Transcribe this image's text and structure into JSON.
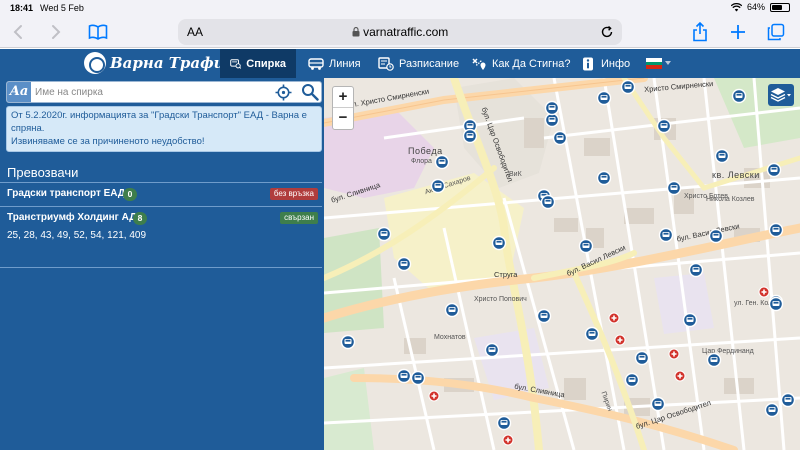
{
  "status_bar": {
    "time": "18:41",
    "date": "Wed 5 Feb",
    "battery": "64%",
    "battery_level": 0.64
  },
  "browser": {
    "aa": "AA",
    "url": "varnatraffic.com"
  },
  "app": {
    "logo_text": "Варна Трафик",
    "nav": [
      {
        "label": "Спирка",
        "icon": "bus-stop-icon",
        "active": true
      },
      {
        "label": "Линия",
        "icon": "bus-icon",
        "active": false
      },
      {
        "label": "Разписание",
        "icon": "timetable-icon",
        "active": false
      },
      {
        "label": "Как Да Стигна?",
        "icon": "directions-icon",
        "active": false
      },
      {
        "label": "Инфо",
        "icon": "info-icon",
        "active": false
      }
    ],
    "language_flag_colors": [
      "#ffffff",
      "#00966e",
      "#d62612"
    ]
  },
  "sidebar": {
    "aa_badge": "Aa",
    "search_placeholder": "Име на спирка",
    "notice": "От 5.2.2020г. информацията за \"Градски Транспорт\" ЕАД - Варна е спряна.\nИзвиняваме се за причиненото неудобство!",
    "carriers_title": "Превозвачи",
    "carriers": [
      {
        "name": "Градски транспорт ЕАД",
        "count": "0",
        "status": "без връзка",
        "connected": false
      },
      {
        "name": "Транстриумф Холдинг АД",
        "count": "8",
        "status": "свързан",
        "connected": true
      }
    ],
    "lines": "25, 28, 43, 49, 52, 54, 121, 409"
  },
  "map": {
    "zoom_in": "+",
    "zoom_out": "−",
    "labels": {
      "hristo_smirnenski": "бул. Христо Смирненски",
      "hristo_smirnenski_2": "Христо Смирненски",
      "pobeda": "Победа",
      "flora": "Флора",
      "vik": "ВиК",
      "kv_levski": "кв. Левски",
      "vasil_levski": "бул. Васил Левски",
      "vasil_levski_2": "бул. Васил Левски",
      "struga": "Струга",
      "slivnitsa": "бул. Сливница",
      "slivnitsa_2": "бул. Сливница",
      "tsar_osvoboditel": "бул. Цар Освободител",
      "tsar_osvoboditel_2": "бул. Цар Освободител",
      "hristo_botev": "Христо Ботев",
      "akad_sakharov": "Акад. Сахаров",
      "pirin": "Пирин",
      "nikola_kozlev": "Никола Козлев",
      "hristo_popovich": "Христо Попович",
      "gen_kolev": "ул. Ген. Колев",
      "tsar_ferdinand": "Цар Фердинанд",
      "mokhnatov": "Мохнатов"
    }
  }
}
